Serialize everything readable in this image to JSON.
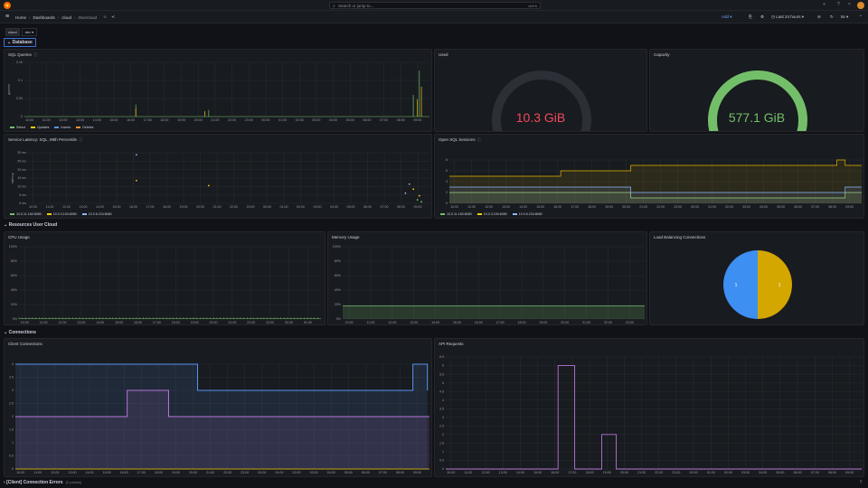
{
  "topbar": {
    "search_placeholder": "Search or jump to...",
    "search_shortcut": "ctrl+k",
    "plus_icon": "+",
    "help_icon": "?",
    "news_icon": "≈"
  },
  "breadcrumbs": [
    "Home",
    "Dashboards",
    "cloud",
    "Overcloud"
  ],
  "toolbar": {
    "add_label": "Add",
    "time_range": "Last 24 hours",
    "refresh_interval": "5s"
  },
  "variables": {
    "label": "cloud",
    "value": "dev"
  },
  "rows": {
    "database": "Database",
    "resources": "Resources User Cloud",
    "connections": "Connections",
    "errors": "[Client] Connection Errors",
    "errors_count": "(2 panels)"
  },
  "colors": {
    "green": "#73bf69",
    "yellow": "#f2cc0c",
    "blue": "#5794f2",
    "orange": "#ff9830",
    "purple": "#b877d9",
    "red": "#f2495c",
    "lightblue": "#8ab8ff",
    "gold": "#e0b400"
  },
  "time_ticks_a": [
    "10:00",
    "11:00",
    "12:00",
    "13:00",
    "14:00",
    "15:00",
    "16:00",
    "17:00",
    "18:00",
    "19:00",
    "20:00",
    "21:00",
    "22:00",
    "23:00",
    "00:00",
    "01:00",
    "02:00",
    "03:00",
    "04:00",
    "05:00",
    "06:00",
    "07:00",
    "08:00",
    "09:00"
  ],
  "panels": {
    "sql_queries": {
      "title": "SQL Queries",
      "ylabel": "queries",
      "yticks": [
        "0.15",
        "0.1",
        "0.05",
        "0"
      ],
      "legend": [
        {
          "name": "Select",
          "color": "#73bf69"
        },
        {
          "name": "Updates",
          "color": "#f2cc0c"
        },
        {
          "name": "Inserts",
          "color": "#5794f2"
        },
        {
          "name": "Deletes",
          "color": "#ff9830"
        }
      ]
    },
    "used": {
      "title": "Used",
      "value": "10.3 GiB",
      "fraction": 0.02
    },
    "capacity": {
      "title": "Capacity",
      "value": "577.1 GiB",
      "fraction": 1.0
    },
    "latency": {
      "title": "Service Latency: SQL, 99th Percentile",
      "ylabel": "latency",
      "yticks": [
        "30 ms",
        "25 ms",
        "20 ms",
        "15 ms",
        "10 ms",
        "5 ms",
        "0 ms"
      ],
      "legend": [
        {
          "name": "10.0.11.160:8080",
          "color": "#73bf69"
        },
        {
          "name": "10.0.3.100:8080",
          "color": "#f2cc0c"
        },
        {
          "name": "10.0.6.234:8080",
          "color": "#8ab8ff"
        }
      ]
    },
    "open_sessions": {
      "title": "Open SQL Sessions",
      "ylabel": "sessions",
      "yticks": [
        "8",
        "6",
        "4",
        "2",
        "0"
      ],
      "legend": [
        {
          "name": "10.0.11.160:8080",
          "color": "#73bf69"
        },
        {
          "name": "10.0.3.100:8080",
          "color": "#f2cc0c"
        },
        {
          "name": "10.0.6.234:8080",
          "color": "#8ab8ff"
        }
      ]
    },
    "cpu": {
      "title": "CPU Usage",
      "yticks": [
        "100%",
        "80%",
        "60%",
        "40%",
        "20%",
        "0%"
      ]
    },
    "memory": {
      "title": "Memory Usage",
      "yticks": [
        "100%",
        "80%",
        "60%",
        "40%",
        "20%",
        "0%"
      ]
    },
    "load_balancing": {
      "title": "Load Balancing Connections",
      "slices": [
        {
          "label": "1",
          "value": 1,
          "color": "#3d8ff2"
        },
        {
          "label": "1",
          "value": 1,
          "color": "#d4a600"
        }
      ]
    },
    "client_connections": {
      "title": "Client Connections",
      "yticks": [
        "4",
        "3.5",
        "3",
        "2.5",
        "2",
        "1.5",
        "1",
        "0.5",
        "0"
      ]
    },
    "api_requests": {
      "title": "API Requests",
      "yticks": [
        "6.5",
        "6",
        "5.5",
        "5",
        "4.5",
        "4",
        "3.5",
        "3",
        "2.5",
        "2",
        "1.5",
        "1",
        "0.5",
        "0"
      ]
    }
  }
}
